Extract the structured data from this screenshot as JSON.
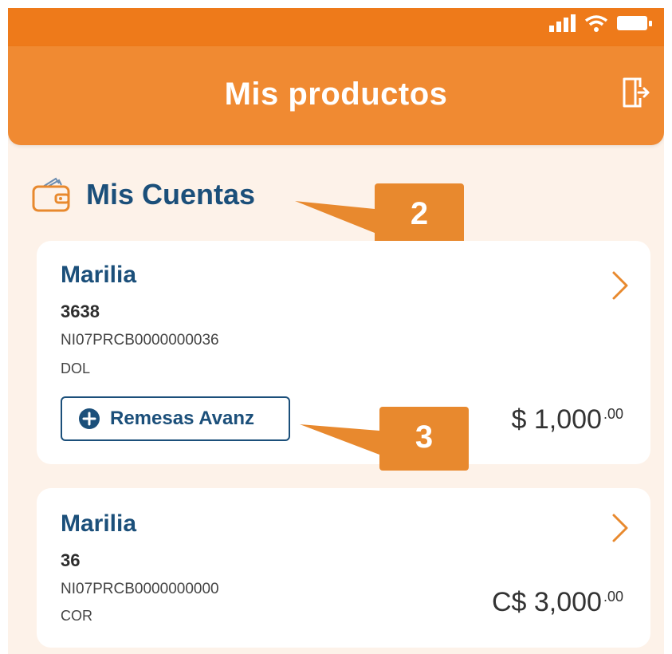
{
  "status_bar": {
    "signal": "signal",
    "wifi": "wifi",
    "battery": "battery"
  },
  "header": {
    "title": "Mis productos",
    "logout_icon": "logout-icon"
  },
  "section": {
    "title": "Mis Cuentas",
    "icon": "wallet-icon"
  },
  "accounts": [
    {
      "name": "Marilia",
      "number": "3638",
      "iban": "NI07PRCB0000000036",
      "currency": "DOL",
      "balance_main": "$ 1,000",
      "balance_cents": ".00",
      "action_label": "Remesas Avanz"
    },
    {
      "name": "Marilia",
      "number": "36",
      "iban": "NI07PRCB0000000000",
      "currency": "COR",
      "balance_main": "C$ 3,000",
      "balance_cents": ".00"
    }
  ],
  "callouts": [
    "2",
    "3"
  ],
  "colors": {
    "orange": "#f08a32",
    "navy": "#1b4f7a",
    "callout": "#e8892e",
    "background": "#fdf2e9"
  }
}
